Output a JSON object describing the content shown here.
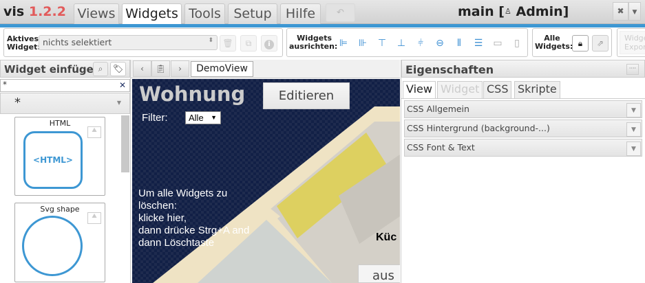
{
  "app": {
    "name": "vis",
    "version": "1.2.2",
    "title_view": "main",
    "title_open": "[",
    "title_user": "Admin",
    "title_close": "]"
  },
  "menu": {
    "tabs": [
      {
        "label": "Views"
      },
      {
        "label": "Widgets",
        "active": true
      },
      {
        "label": "Tools"
      },
      {
        "label": "Setup"
      },
      {
        "label": "Hilfe"
      }
    ],
    "undo_icon": "undo-icon"
  },
  "toolbar": {
    "active_widget_label": "Aktives Widget:",
    "active_widget_value": "nichts selektiert",
    "align_label": "Widgets ausrichten:",
    "all_widgets_label": "Alle Widgets:",
    "export_label": "Widgets Exportieren"
  },
  "left": {
    "title": "Widget einfügen",
    "filter_value": "*",
    "set_value": "*",
    "widgets": [
      {
        "name": "HTML",
        "preview": "<HTML>"
      },
      {
        "name": "Svg shape"
      }
    ]
  },
  "center": {
    "view_tab": "DemoView"
  },
  "canvas": {
    "heading": "Wohnung",
    "edit_button": "Editieren",
    "filter_label": "Filter:",
    "filter_value": "Alle",
    "hint_lines": [
      "Um alle Widgets zu",
      "löschen:",
      "klicke hier,",
      "dann drücke Strg+A and",
      "dann Löschtaste"
    ],
    "room_label": "Küc",
    "bottom_button": "aus"
  },
  "right": {
    "title": "Eigenschaften",
    "tabs": [
      {
        "label": "View",
        "active": true
      },
      {
        "label": "Widget",
        "disabled": true
      },
      {
        "label": "CSS"
      },
      {
        "label": "Skripte"
      }
    ],
    "sections": [
      {
        "label": "CSS Allgemein"
      },
      {
        "label": "CSS Hintergrund (background-...)"
      },
      {
        "label": "CSS Font & Text"
      }
    ]
  },
  "colors": {
    "accent": "#3d97d3",
    "version": "#e25a5a"
  }
}
